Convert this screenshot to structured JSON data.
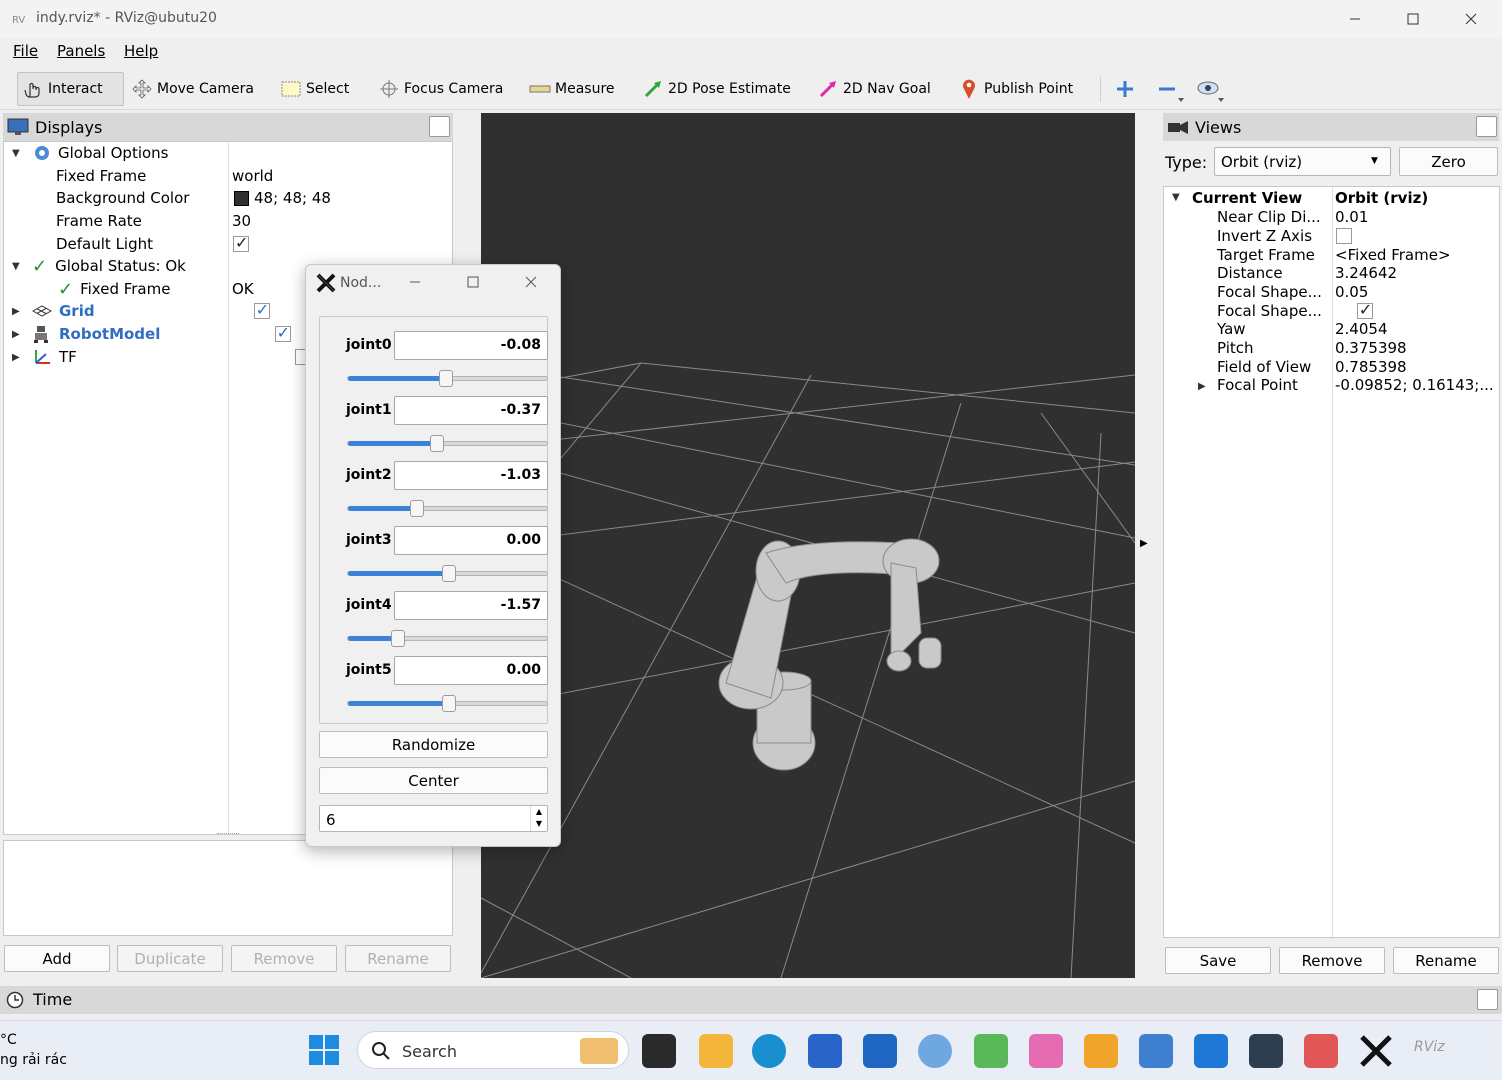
{
  "window": {
    "title": "indy.rviz* - RViz@ubutu20"
  },
  "menu": [
    {
      "label": "File"
    },
    {
      "label": "Panels"
    },
    {
      "label": "Help"
    }
  ],
  "toolbar": {
    "tools": [
      {
        "label": "Interact",
        "icon": "hand-pointer-icon",
        "active": true
      },
      {
        "label": "Move Camera",
        "icon": "move-camera-icon"
      },
      {
        "label": "Select",
        "icon": "select-rectangle-icon"
      },
      {
        "label": "Focus Camera",
        "icon": "focus-camera-icon"
      },
      {
        "label": "Measure",
        "icon": "ruler-icon"
      },
      {
        "label": "2D Pose Estimate",
        "icon": "green-arrow-icon"
      },
      {
        "label": "2D Nav Goal",
        "icon": "magenta-arrow-icon"
      },
      {
        "label": "Publish Point",
        "icon": "map-pin-icon"
      }
    ]
  },
  "displays": {
    "title": "Displays",
    "rows": [
      {
        "name": "Global Options",
        "value": ""
      },
      {
        "name": "Fixed Frame",
        "value": "world"
      },
      {
        "name": "Background Color",
        "value": "48; 48; 48"
      },
      {
        "name": "Frame Rate",
        "value": "30"
      },
      {
        "name": "Default Light",
        "value": ""
      },
      {
        "name": "Global Status: Ok",
        "value": ""
      },
      {
        "name": "Fixed Frame",
        "value": "OK"
      },
      {
        "name": "Grid",
        "value": ""
      },
      {
        "name": "RobotModel",
        "value": ""
      },
      {
        "name": "TF",
        "value": ""
      }
    ],
    "buttons": {
      "add": "Add",
      "duplicate": "Duplicate",
      "remove": "Remove",
      "rename": "Rename"
    }
  },
  "joint_dialog": {
    "title": "Nod...",
    "joints": [
      {
        "name": "joint0",
        "value": "-0.08",
        "slider_fraction": 0.49
      },
      {
        "name": "joint1",
        "value": "-0.37",
        "slider_fraction": 0.445
      },
      {
        "name": "joint2",
        "value": "-1.03",
        "slider_fraction": 0.345
      },
      {
        "name": "joint3",
        "value": "0.00",
        "slider_fraction": 0.5
      },
      {
        "name": "joint4",
        "value": "-1.57",
        "slider_fraction": 0.25
      },
      {
        "name": "joint5",
        "value": "0.00",
        "slider_fraction": 0.5
      }
    ],
    "randomize": "Randomize",
    "center": "Center",
    "spin_value": "6"
  },
  "views": {
    "title": "Views",
    "type_label": "Type:",
    "type_value": "Orbit (rviz)",
    "zero": "Zero",
    "current_view": {
      "name": "Current View",
      "value": "Orbit (rviz)"
    },
    "props": [
      {
        "name": "Near Clip Di...",
        "value": "0.01"
      },
      {
        "name": "Invert Z Axis",
        "value": ""
      },
      {
        "name": "Target Frame",
        "value": "<Fixed Frame>"
      },
      {
        "name": "Distance",
        "value": "3.24642"
      },
      {
        "name": "Focal Shape...",
        "value": "0.05"
      },
      {
        "name": "Focal Shape...",
        "value": ""
      },
      {
        "name": "Yaw",
        "value": "2.4054"
      },
      {
        "name": "Pitch",
        "value": "0.375398"
      },
      {
        "name": "Field of View",
        "value": "0.785398"
      },
      {
        "name": "Focal Point",
        "value": "-0.09852; 0.16143;..."
      }
    ],
    "buttons": {
      "save": "Save",
      "remove": "Remove",
      "rename": "Rename"
    }
  },
  "time_panel": {
    "title": "Time"
  },
  "taskbar": {
    "weather_temp": "°C",
    "weather_text": "ng rải rác",
    "search_placeholder": "Search"
  },
  "colors": {
    "background": "#303030",
    "accent": "#2f6ec2",
    "grid": "#a0a0a0"
  }
}
